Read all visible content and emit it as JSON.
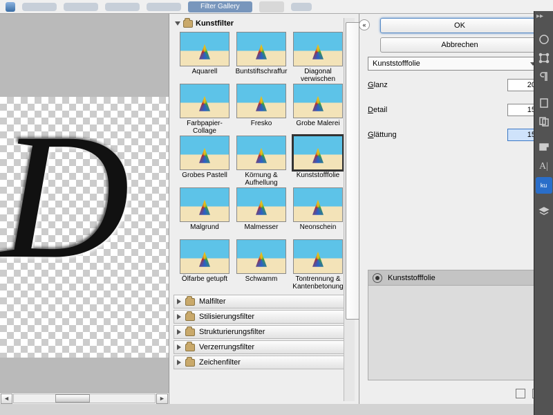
{
  "menu": {
    "active_tab": "Filter Gallery"
  },
  "close_label": "✕",
  "preview_letter": "D",
  "categories": {
    "open": "Kunstfilter",
    "closed": [
      "Malfilter",
      "Stilisierungsfilter",
      "Strukturierungsfilter",
      "Verzerrungsfilter",
      "Zeichenfilter"
    ]
  },
  "thumbnails": [
    "Aquarell",
    "Buntstiftschraffur",
    "Diagonal verwischen",
    "Farbpapier-Collage",
    "Fresko",
    "Grobe Malerei",
    "Grobes Pastell",
    "Körnung & Aufhellung",
    "Kunststofffolie",
    "Malgrund",
    "Malmesser",
    "Neonschein",
    "Ölfarbe getupft",
    "Schwamm",
    "Tontrennung & Kantenbetonung"
  ],
  "selected_thumb_index": 8,
  "buttons": {
    "ok": "OK",
    "cancel": "Abbrechen"
  },
  "filter_dropdown": "Kunststofffolie",
  "params": [
    {
      "label": "Glanz",
      "value": "20",
      "focus": false
    },
    {
      "label": "Detail",
      "value": "15",
      "focus": false
    },
    {
      "label": "Glättung",
      "value": "15",
      "focus": true
    }
  ],
  "layer_name": "Kunststofffolie",
  "side_tools": [
    "color",
    "crop",
    "para",
    "sep",
    "rect",
    "copy",
    "sep",
    "grid",
    "type",
    "kuler",
    "sep",
    "layers"
  ]
}
